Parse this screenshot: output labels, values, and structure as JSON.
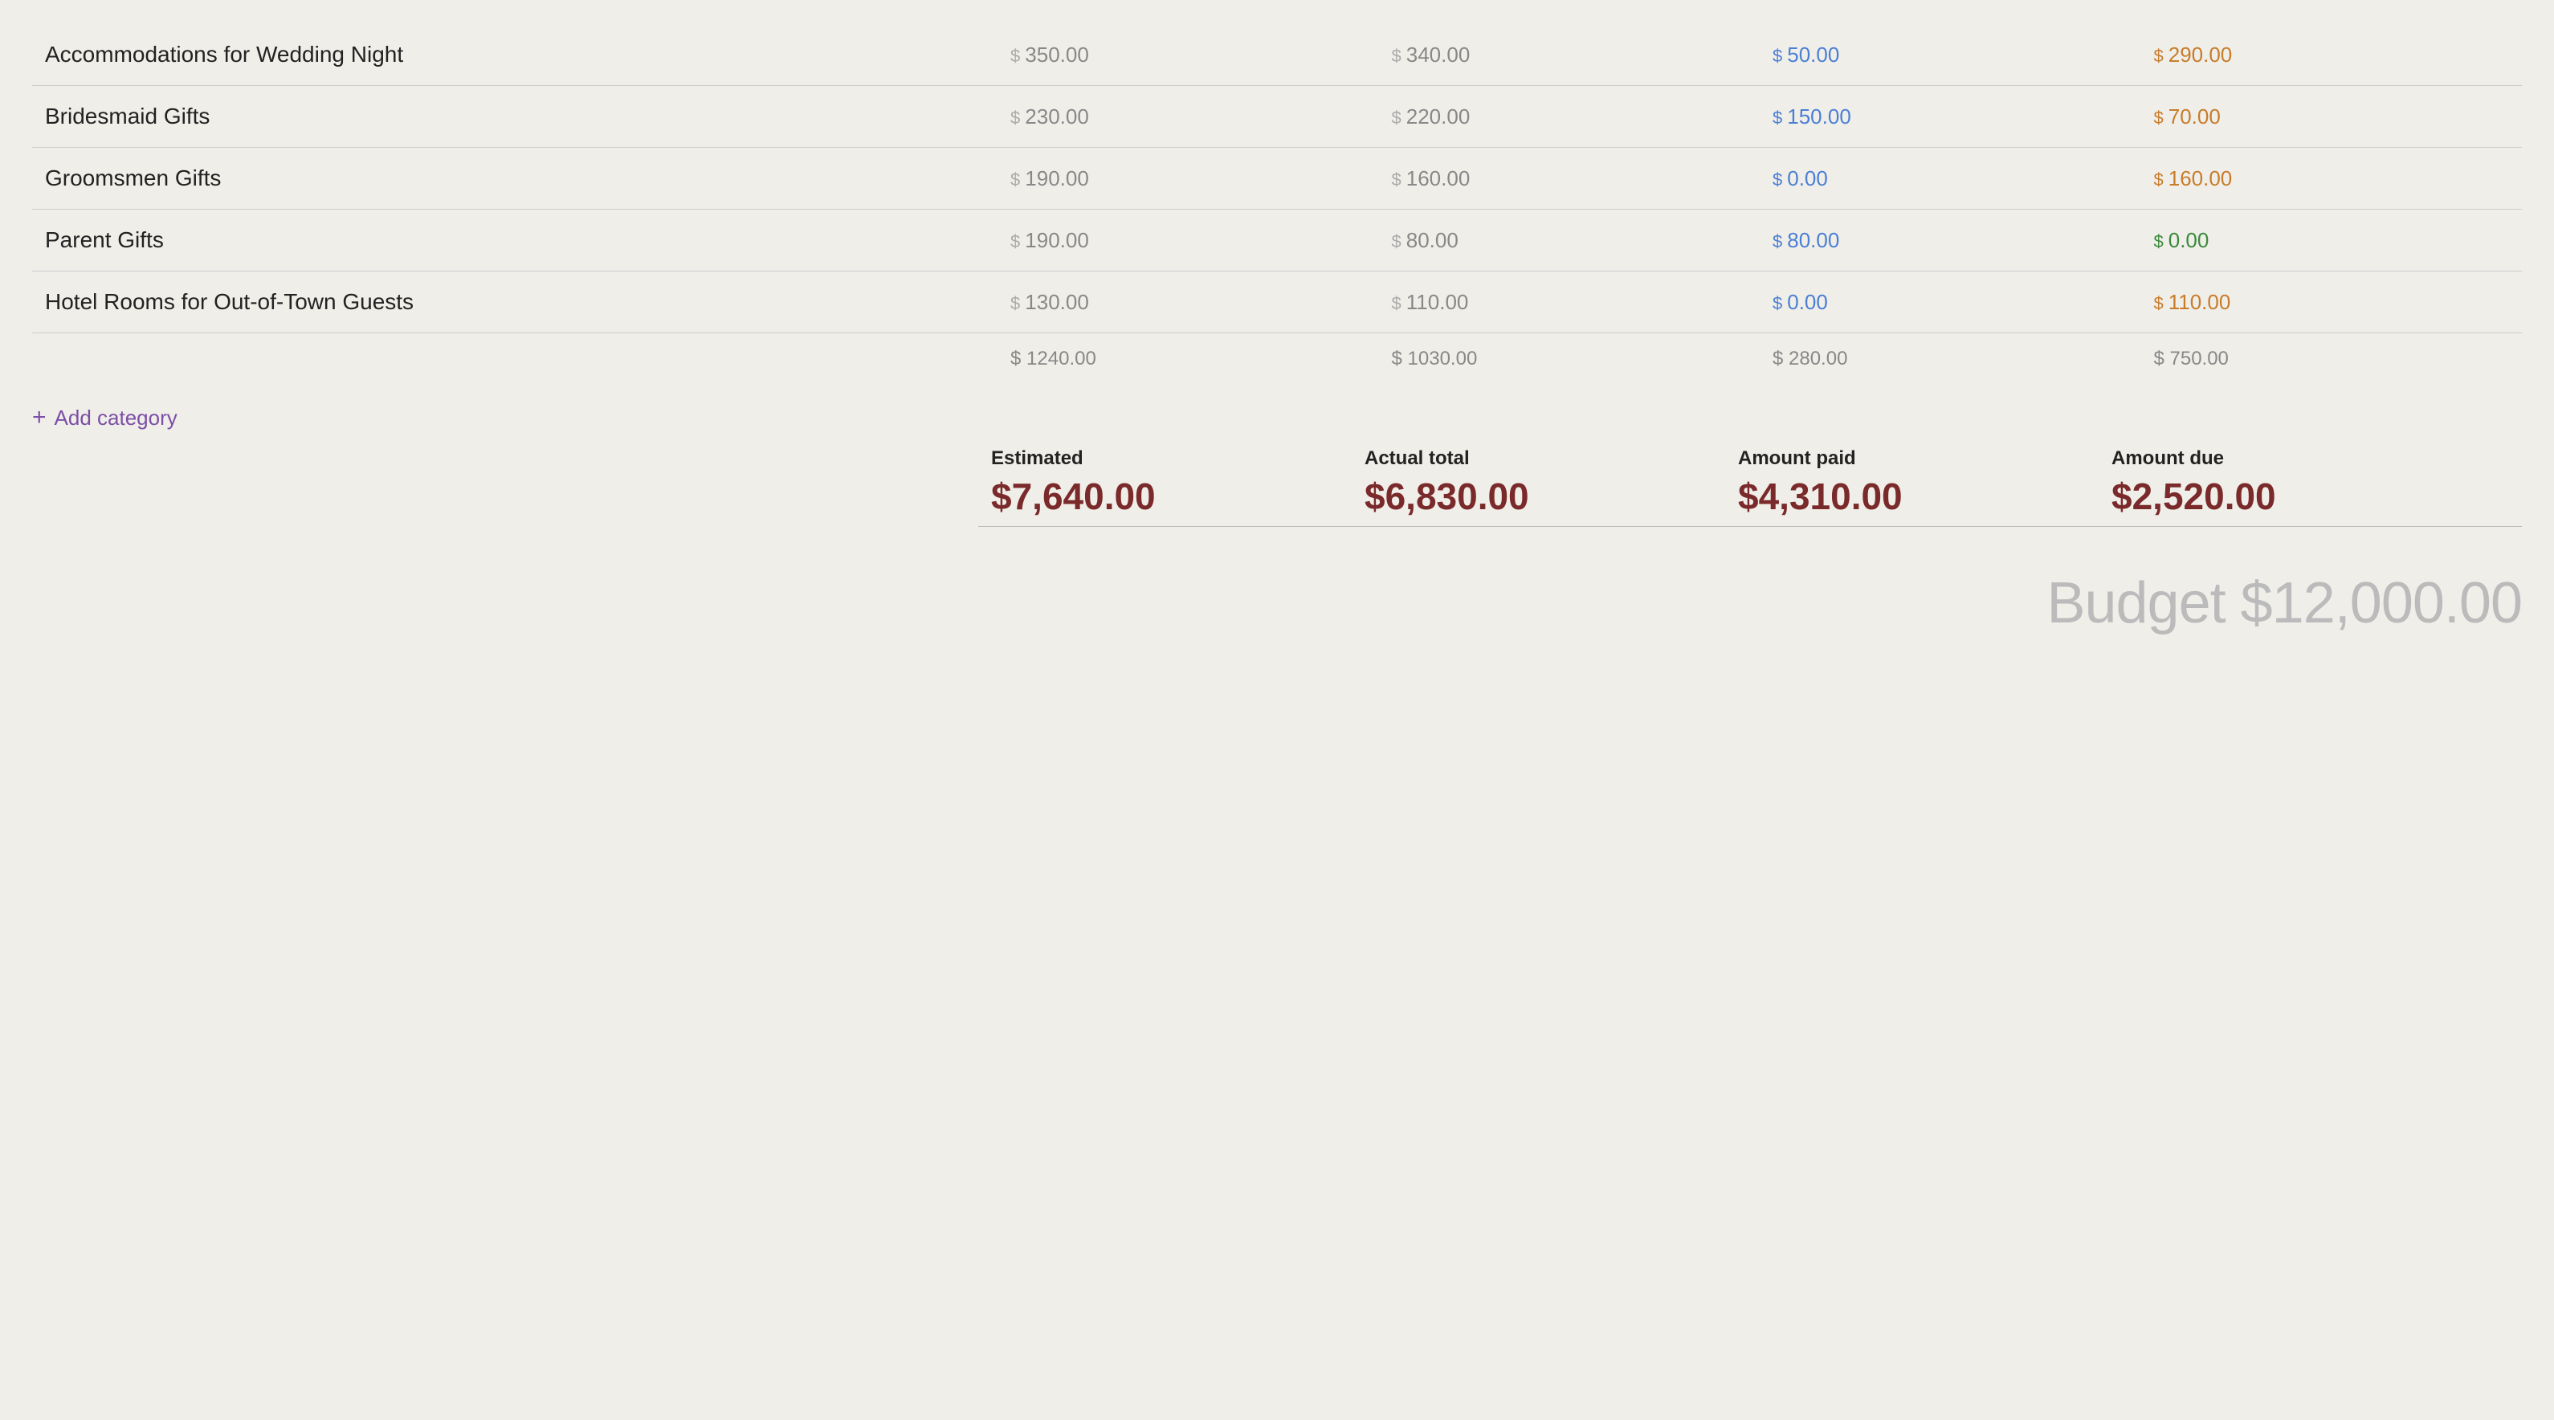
{
  "rows": [
    {
      "name": "Accommodations for Wedding Night",
      "estimated": "350.00",
      "actual": "340.00",
      "paid": "50.00",
      "due": "290.00",
      "paid_color": "blue",
      "due_color": "orange"
    },
    {
      "name": "Bridesmaid Gifts",
      "estimated": "230.00",
      "actual": "220.00",
      "paid": "150.00",
      "due": "70.00",
      "paid_color": "blue",
      "due_color": "orange"
    },
    {
      "name": "Groomsmen Gifts",
      "estimated": "190.00",
      "actual": "160.00",
      "paid": "0.00",
      "due": "160.00",
      "paid_color": "blue",
      "due_color": "orange"
    },
    {
      "name": "Parent Gifts",
      "estimated": "190.00",
      "actual": "80.00",
      "paid": "80.00",
      "due": "0.00",
      "paid_color": "blue",
      "due_color": "green"
    },
    {
      "name": "Hotel Rooms for Out-of-Town Guests",
      "estimated": "130.00",
      "actual": "110.00",
      "paid": "0.00",
      "due": "110.00",
      "paid_color": "blue",
      "due_color": "orange"
    }
  ],
  "subtotals": {
    "estimated": "$ 1240.00",
    "actual": "$ 1030.00",
    "paid": "$ 280.00",
    "due": "$ 750.00"
  },
  "add_category_label": "Add category",
  "summary": {
    "estimated_label": "Estimated",
    "estimated_value": "$7,640.00",
    "actual_label": "Actual total",
    "actual_value": "$6,830.00",
    "paid_label": "Amount paid",
    "paid_value": "$4,310.00",
    "due_label": "Amount due",
    "due_value": "$2,520.00"
  },
  "budget_total": "Budget $12,000.00"
}
